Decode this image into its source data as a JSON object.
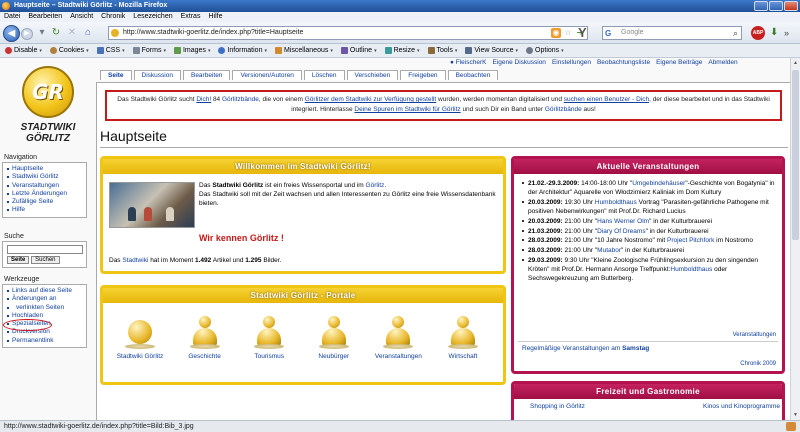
{
  "browser": {
    "title": "Hauptseite – Stadtwiki Görlitz - Mozilla Firefox",
    "menu": [
      "Datei",
      "Bearbeiten",
      "Ansicht",
      "Chronik",
      "Lesezeichen",
      "Extras",
      "Hilfe"
    ],
    "url": "http://www.stadtwiki-goerlitz.de/index.php?title=Hauptseite",
    "search_placeholder": "Google",
    "search_engine": "G",
    "abp_label": "ABP",
    "webdev_toolbar": [
      "Disable",
      "Cookies",
      "CSS",
      "Forms",
      "Images",
      "Information",
      "Miscellaneous",
      "Outline",
      "Resize",
      "Tools",
      "View Source",
      "Options"
    ],
    "status_text": "http://www.stadtwiki-goerlitz.de/index.php?title=Bild:Bib_3.jpg"
  },
  "user_links": [
    "FleischerK",
    "Eigene Diskussion",
    "Einstellungen",
    "Beobachtungsliste",
    "Eigene Beiträge",
    "Abmelden"
  ],
  "tabs": [
    {
      "label": "Seite",
      "active": true
    },
    {
      "label": "Diskussion"
    },
    {
      "label": "Bearbeiten"
    },
    {
      "label": "Versionen/Autoren"
    },
    {
      "label": "Löschen"
    },
    {
      "label": "Verschieben"
    },
    {
      "label": "Freigeben"
    },
    {
      "label": "Beobachten"
    }
  ],
  "logo": {
    "mono": "GR",
    "line1": "STADTWIKI",
    "line2": "GÖRLITZ"
  },
  "sidebar": {
    "navigation_title": "Navigation",
    "navigation": [
      "Hauptseite",
      "Stadtwiki Görlitz",
      "Veranstaltungen",
      "Letzte Änderungen",
      "Zufällige Seite",
      "Hilfe"
    ],
    "search_title": "Suche",
    "search_go": "Seite",
    "search_search": "Suchen",
    "tools_title": "Werkzeuge",
    "tools": [
      "Links auf diese Seite",
      "Änderungen an",
      "verlinkten Seiten",
      "Hochladen",
      "Spezialseiten",
      "Druckversion",
      "Permanentlink"
    ]
  },
  "notice": {
    "p1": "Das Stadtwiki Görlitz sucht ",
    "l1": "Dich!",
    "p2": " 84 ",
    "l2": "Görlitzbände",
    "p3": ", die von einem ",
    "l3": "Görlitzer dem Stadtwiki zur Verfügung gestellt",
    "p4": " wurden, werden momentan digitalisiert und ",
    "l4": "suchen einen Benutzer - Dich",
    "p5": ", der diese bearbeitet und in das Stadtwiki integriert. Hinterlasse ",
    "l5": "Deine Spuren im Stadtwiki für Görlitz",
    "p6": " und such Dir ein Band unter ",
    "l6": "Görlitzbände",
    "p7": " aus!"
  },
  "page_title": "Hauptseite",
  "welcome": {
    "header": "Willkommen im Stadtwiki Görlitz!",
    "t1a": "Das ",
    "t1b": "Stadtwiki Görlitz",
    "t1c": " ist ein freies Wissensportal und im ",
    "t1d": "Görlitz",
    "t1e": ".",
    "t2": "Das Stadtwiki soll mit der Zeit wachsen und allen Interessenten zu Görlitz eine freie Wissensdatenbank bieten.",
    "know": "Wir kennen Görlitz !",
    "s1": "Das ",
    "s2": "Stadtwiki",
    "s3": " hat im Moment ",
    "articles": "1.492",
    "s4": " Artikel und ",
    "images": "1.295",
    "s5": " Bilder."
  },
  "portals": {
    "header": "Stadtwiki Görlitz - Portale",
    "items": [
      "Stadtwiki Görlitz",
      "Geschichte",
      "Tourismus",
      "Neubürger",
      "Veranstaltungen",
      "Wirtschaft"
    ]
  },
  "events": {
    "header": "Aktuelle Veranstaltungen",
    "items": [
      {
        "date": "21.02.-29.3.2009:",
        "text": " 14:00-18:00 Uhr \"",
        "link": "Umgebindehäuser",
        "rest": "\"-Geschichte von Bogatynia\" in der Architektur\" Aquarelle von Włodzimierz Kaliniak im Dom Kultury"
      },
      {
        "date": "20.03.2009:",
        "text": " 19:30 Uhr ",
        "link": "Humboldthaus",
        "rest": " Vortrag \"Parasiten-gefährliche Pathogene mit positiven Nebenwirkungen\" mit Prof.Dr. Richard Lucius"
      },
      {
        "date": "20.03.2009:",
        "text": " 21:00 Uhr \"",
        "link": "Hans Werner Olm",
        "rest": "\" in der Kulturbrauerei"
      },
      {
        "date": "21.03.2009:",
        "text": " 21:00 Uhr \"",
        "link": "Diary Of Dreams",
        "rest": "\" in der Kulturbrauerei"
      },
      {
        "date": "28.03.2009:",
        "text": " 21:00 Uhr \"10 Jahre Nostromo\" mit ",
        "link": "Project Pitchfork",
        "rest": " im Nostromo"
      },
      {
        "date": "28.03.2009:",
        "text": " 21:00 Uhr \"",
        "link": "Mutabor",
        "rest": "\" in der Kulturbrauerei"
      },
      {
        "date": "29.03.2009:",
        "text": " 9:30 Uhr \"Kleine Zoologische Frühlingsexkursion zu den singenden Kröten\" mit Prof.Dr. Hermann Ansorge Treffpunkt:",
        "link": "Humboldthaus",
        "rest": " oder Sechswegekreuzung am Butterberg."
      }
    ],
    "more": "Veranstaltungen",
    "regular_a": "Regelmäßige Veranstaltungen am ",
    "regular_b": "Samstag",
    "chronik": "Chronik 2009"
  },
  "food": {
    "header": "Freizeit und Gastronomie",
    "items": [
      "Shopping in Görlitz",
      "Kinos und Kinoprogramme"
    ]
  },
  "colors": {
    "accent_yellow": "#f0c613",
    "accent_red": "#b3134e",
    "link": "#1040a0",
    "notice_border": "#c41a1a"
  }
}
